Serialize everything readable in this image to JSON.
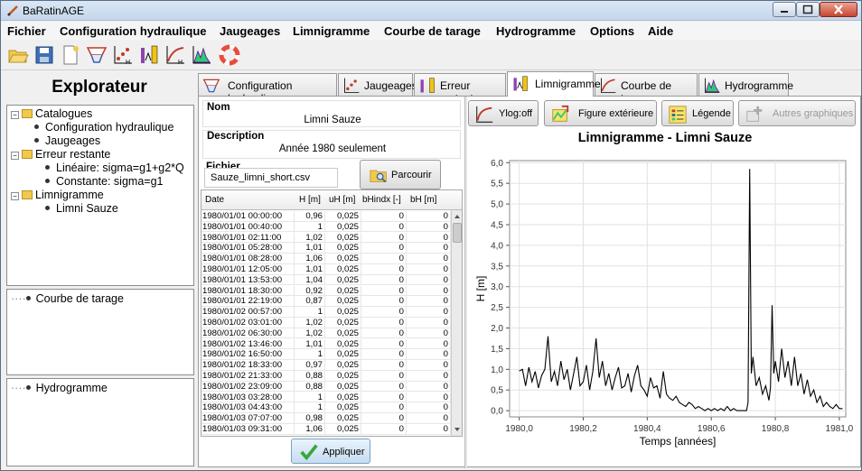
{
  "app": {
    "title": "BaRatinAGE"
  },
  "menu": [
    "Fichier",
    "Configuration hydraulique",
    "Jaugeages",
    "Limnigramme",
    "Courbe de tarage",
    "Hydrogramme",
    "Options",
    "Aide"
  ],
  "toolbar_icons": [
    "open-folder-icon",
    "save-icon",
    "new-document-icon",
    "hydraulic-config-icon",
    "gaugings-icon",
    "remnant-error-icon",
    "rating-curve-icon",
    "hydrograph-icon",
    "help-lifebuoy-icon"
  ],
  "explorer": {
    "title": "Explorateur",
    "tree": [
      {
        "label": "Catalogues",
        "type": "folder",
        "level": 0
      },
      {
        "label": "Configuration hydraulique",
        "type": "leaf",
        "level": 1
      },
      {
        "label": "Jaugeages",
        "type": "leaf",
        "level": 1
      },
      {
        "label": "Erreur restante",
        "type": "folder",
        "level": 0
      },
      {
        "label": "Linéaire: sigma=g1+g2*Q",
        "type": "leaf",
        "level": 2
      },
      {
        "label": "Constante: sigma=g1",
        "type": "leaf",
        "level": 2
      },
      {
        "label": "Limnigramme",
        "type": "folder",
        "level": 0
      },
      {
        "label": "Limni Sauze",
        "type": "leaf",
        "level": 2
      }
    ],
    "panel2": "Courbe de tarage",
    "panel3": "Hydrogramme"
  },
  "tabs": [
    {
      "label": "Configuration hydraulique"
    },
    {
      "label": "Jaugeages"
    },
    {
      "label": "Erreur restante"
    },
    {
      "label": "Limnigramme"
    },
    {
      "label": "Courbe de tarage"
    },
    {
      "label": "Hydrogramme"
    }
  ],
  "active_tab": "Limnigramme",
  "form": {
    "nom_label": "Nom",
    "nom_value": "Limni Sauze",
    "desc_label": "Description",
    "desc_value": "Année 1980 seulement",
    "fichier_label": "Fichier",
    "fichier_value": "Sauze_limni_short.csv",
    "browse_label": "Parcourir",
    "apply_label": "Appliquer"
  },
  "table": {
    "headers": [
      "Date",
      "H [m]",
      "uH [m]",
      "bHindx [-]",
      "bH [m]"
    ],
    "rows": [
      [
        "1980/01/01 00:00:00",
        "0,96",
        "0,025",
        "0",
        "0"
      ],
      [
        "1980/01/01 00:40:00",
        "1",
        "0,025",
        "0",
        "0"
      ],
      [
        "1980/01/01 02:11:00",
        "1,02",
        "0,025",
        "0",
        "0"
      ],
      [
        "1980/01/01 05:28:00",
        "1,01",
        "0,025",
        "0",
        "0"
      ],
      [
        "1980/01/01 08:28:00",
        "1,06",
        "0,025",
        "0",
        "0"
      ],
      [
        "1980/01/01 12:05:00",
        "1,01",
        "0,025",
        "0",
        "0"
      ],
      [
        "1980/01/01 13:53:00",
        "1,04",
        "0,025",
        "0",
        "0"
      ],
      [
        "1980/01/01 18:30:00",
        "0,92",
        "0,025",
        "0",
        "0"
      ],
      [
        "1980/01/01 22:19:00",
        "0,87",
        "0,025",
        "0",
        "0"
      ],
      [
        "1980/01/02 00:57:00",
        "1",
        "0,025",
        "0",
        "0"
      ],
      [
        "1980/01/02 03:01:00",
        "1,02",
        "0,025",
        "0",
        "0"
      ],
      [
        "1980/01/02 06:30:00",
        "1,02",
        "0,025",
        "0",
        "0"
      ],
      [
        "1980/01/02 13:46:00",
        "1,01",
        "0,025",
        "0",
        "0"
      ],
      [
        "1980/01/02 16:50:00",
        "1",
        "0,025",
        "0",
        "0"
      ],
      [
        "1980/01/02 18:33:00",
        "0,97",
        "0,025",
        "0",
        "0"
      ],
      [
        "1980/01/02 21:33:00",
        "0,88",
        "0,025",
        "0",
        "0"
      ],
      [
        "1980/01/02 23:09:00",
        "0,88",
        "0,025",
        "0",
        "0"
      ],
      [
        "1980/01/03 03:28:00",
        "1",
        "0,025",
        "0",
        "0"
      ],
      [
        "1980/01/03 04:43:00",
        "1",
        "0,025",
        "0",
        "0"
      ],
      [
        "1980/01/03 07:07:00",
        "0,98",
        "0,025",
        "0",
        "0"
      ],
      [
        "1980/01/03 09:31:00",
        "1,06",
        "0,025",
        "0",
        "0"
      ]
    ]
  },
  "graph_buttons": [
    {
      "label": "Ylog:off",
      "enabled": true
    },
    {
      "label": "Figure extérieure",
      "enabled": true
    },
    {
      "label": "Légende",
      "enabled": true
    },
    {
      "label": "Autres graphiques",
      "enabled": false
    }
  ],
  "chart_data": {
    "type": "line",
    "title": "Limnigramme - Limni Sauze",
    "xlabel": "Temps [années]",
    "ylabel": "H [m]",
    "xlim": [
      1979.97,
      1981.02
    ],
    "ylim": [
      -0.15,
      6.05
    ],
    "xticks": [
      "1980,0",
      "1980,2",
      "1980,4",
      "1980,6",
      "1980,8",
      "1981,0"
    ],
    "yticks": [
      "0,0",
      "0,5",
      "1,0",
      "1,5",
      "2,0",
      "2,5",
      "3,0",
      "3,5",
      "4,0",
      "4,5",
      "5,0",
      "5,5",
      "6,0"
    ],
    "grid": true,
    "series": [
      {
        "x": [
          1980.0,
          1980.01,
          1980.02,
          1980.03,
          1980.04,
          1980.05,
          1980.06,
          1980.07,
          1980.08,
          1980.09,
          1980.1,
          1980.11,
          1980.12,
          1980.13,
          1980.14,
          1980.15,
          1980.16,
          1980.17,
          1980.18,
          1980.19,
          1980.2,
          1980.21,
          1980.22,
          1980.23,
          1980.24,
          1980.25,
          1980.26,
          1980.27,
          1980.28,
          1980.29,
          1980.3,
          1980.31,
          1980.32,
          1980.33,
          1980.34,
          1980.35,
          1980.36,
          1980.37,
          1980.38,
          1980.39,
          1980.4,
          1980.41,
          1980.42,
          1980.43,
          1980.44,
          1980.45,
          1980.46,
          1980.47,
          1980.48,
          1980.49,
          1980.5,
          1980.51,
          1980.52,
          1980.53,
          1980.54,
          1980.55,
          1980.56,
          1980.57,
          1980.58,
          1980.59,
          1980.6,
          1980.61,
          1980.62,
          1980.63,
          1980.64,
          1980.65,
          1980.66,
          1980.67,
          1980.68,
          1980.69,
          1980.7,
          1980.71,
          1980.715,
          1980.72,
          1980.725,
          1980.73,
          1980.74,
          1980.75,
          1980.76,
          1980.77,
          1980.78,
          1980.785,
          1980.79,
          1980.795,
          1980.8,
          1980.81,
          1980.82,
          1980.83,
          1980.84,
          1980.85,
          1980.86,
          1980.87,
          1980.88,
          1980.89,
          1980.9,
          1980.91,
          1980.92,
          1980.93,
          1980.94,
          1980.95,
          1980.96,
          1980.97,
          1980.98,
          1980.99,
          1981.0,
          1981.01
        ],
        "y": [
          0.96,
          1.0,
          0.6,
          1.05,
          0.7,
          0.95,
          0.55,
          0.85,
          1.0,
          1.8,
          0.7,
          0.95,
          0.6,
          1.2,
          0.75,
          1.0,
          0.5,
          0.9,
          1.3,
          0.6,
          0.7,
          1.1,
          0.5,
          0.95,
          1.75,
          0.8,
          1.2,
          0.6,
          0.9,
          0.5,
          0.8,
          1.05,
          0.55,
          0.6,
          0.9,
          0.45,
          0.85,
          1.1,
          0.6,
          0.5,
          0.35,
          0.8,
          0.55,
          0.6,
          0.3,
          0.95,
          0.4,
          0.3,
          0.25,
          0.35,
          0.2,
          0.15,
          0.1,
          0.2,
          0.15,
          0.05,
          0.1,
          0.05,
          0.0,
          0.05,
          0.0,
          0.05,
          0.0,
          0.05,
          0.0,
          0.1,
          0.0,
          0.05,
          0.0,
          0.0,
          0.0,
          0.0,
          0.2,
          5.85,
          0.9,
          1.3,
          0.6,
          0.8,
          0.4,
          0.6,
          0.25,
          0.55,
          2.55,
          0.9,
          1.2,
          0.7,
          1.5,
          0.8,
          1.2,
          0.6,
          1.3,
          0.6,
          0.9,
          0.4,
          0.75,
          0.35,
          0.5,
          0.2,
          0.35,
          0.1,
          0.2,
          0.1,
          0.05,
          0.15,
          0.05,
          0.05
        ]
      }
    ]
  }
}
